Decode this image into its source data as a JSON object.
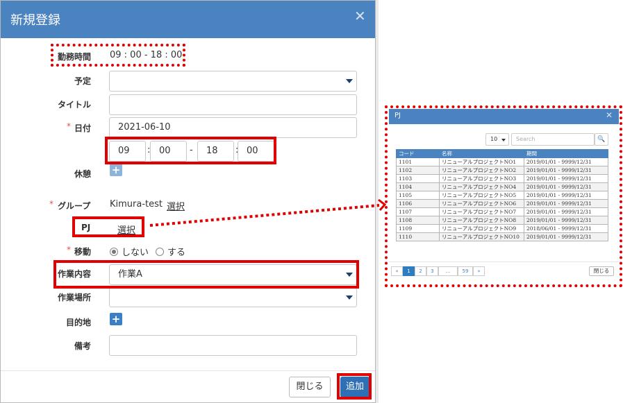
{
  "modal": {
    "title": "新規登録",
    "close_glyph": "✕",
    "work_time": {
      "label": "勤務時間",
      "value": "09 : 00 - 18 : 00"
    },
    "schedule": {
      "label": "予定",
      "value": ""
    },
    "title_field": {
      "label": "タイトル",
      "value": ""
    },
    "date": {
      "required_mark": "*",
      "label": "日付",
      "value": "2021-06-10",
      "start_hour": "09",
      "start_min": "00",
      "end_hour": "18",
      "end_min": "00",
      "colon": ":",
      "dash": "-"
    },
    "break": {
      "label": "休憩",
      "add_glyph": "+"
    },
    "group": {
      "required_mark": "*",
      "label": "グループ",
      "value": "Kimura-test",
      "select_link": "選択"
    },
    "pj": {
      "label": "PJ",
      "select_link": "選択"
    },
    "move": {
      "required_mark": "*",
      "label": "移動",
      "option_no": "しない",
      "option_yes": "する",
      "selected": "しない"
    },
    "work_content": {
      "label": "作業内容",
      "value": "作業A"
    },
    "work_place": {
      "label": "作業場所",
      "value": ""
    },
    "destination": {
      "label": "目的地",
      "add_glyph": "+"
    },
    "remarks": {
      "label": "備考",
      "value": ""
    },
    "buttons": {
      "close": "閉じる",
      "add": "追加"
    }
  },
  "pj_dialog": {
    "title": "PJ",
    "close_glyph": "✕",
    "page_size": "10",
    "search_placeholder": "Search",
    "search_glyph": "🔍",
    "columns": [
      "コード",
      "名称",
      "期間"
    ],
    "rows": [
      [
        "1101",
        "リニューアルプロジェクトNO1",
        "2019/01/01 - 9999/12/31"
      ],
      [
        "1102",
        "リニューアルプロジェクトNO2",
        "2019/01/01 - 9999/12/31"
      ],
      [
        "1103",
        "リニューアルプロジェクトNO3",
        "2019/01/01 - 9999/12/31"
      ],
      [
        "1104",
        "リニューアルプロジェクトNO4",
        "2019/01/01 - 9999/12/31"
      ],
      [
        "1105",
        "リニューアルプロジェクトNO5",
        "2019/01/01 - 9999/12/31"
      ],
      [
        "1106",
        "リニューアルプロジェクトNO6",
        "2019/01/01 - 9999/12/31"
      ],
      [
        "1107",
        "リニューアルプロジェクトNO7",
        "2019/01/01 - 9999/12/31"
      ],
      [
        "1108",
        "リニューアルプロジェクトNO8",
        "2019/01/01 - 9999/12/31"
      ],
      [
        "1109",
        "リニューアルプロジェクトNO9",
        "2018/06/01 - 9999/12/31"
      ],
      [
        "1110",
        "リニューアルプロジェクトNO10",
        "2019/01/01 - 9999/12/31"
      ]
    ],
    "pagination": [
      "«",
      "1",
      "2",
      "3",
      "...",
      "59",
      "»"
    ],
    "active_page": "1",
    "close_button": "閉じる"
  },
  "colors": {
    "header_blue": "#4a83c0",
    "annotation_red": "#e00000",
    "primary_button": "#2f6fb6"
  }
}
